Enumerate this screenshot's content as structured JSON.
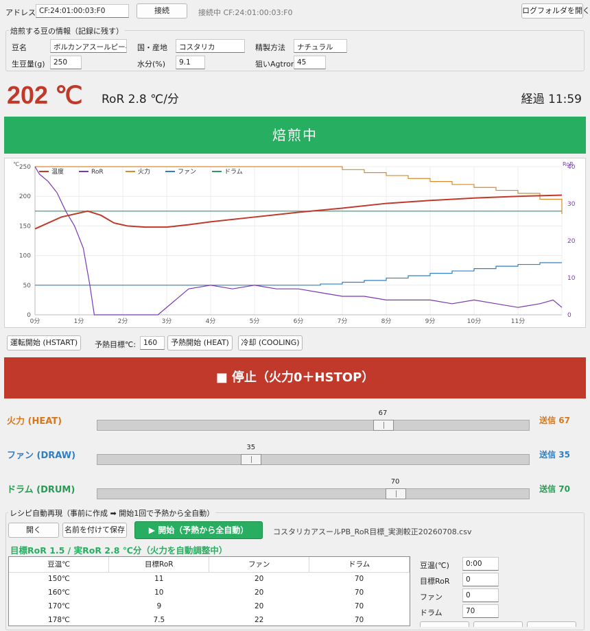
{
  "connection": {
    "address_label": "アドレス:",
    "address_value": "CF:24:01:00:03:F0",
    "connect_button": "接続",
    "status": "接続中 CF:24:01:00:03:F0",
    "log_folder_button": "ログフォルダを開く"
  },
  "bean_info": {
    "title": "焙煎する豆の情報（記録に残す）",
    "name_label": "豆名",
    "name_value": "ボルカンアスールピーベリ",
    "origin_label": "国・産地",
    "origin_value": "コスタリカ",
    "process_label": "精製方法",
    "process_value": "ナチュラル",
    "weight_label": "生豆量(g)",
    "weight_value": "250",
    "moisture_label": "水分(%)",
    "moisture_value": "9.1",
    "agtron_label": "狙いAgtron",
    "agtron_value": "45"
  },
  "readout": {
    "temperature": "202 ℃",
    "ror": "RoR 2.8 ℃/分",
    "elapsed": "経過 11:59"
  },
  "status_banner": "焙煎中",
  "colors": {
    "banner": "#27ae60",
    "stop": "#c0392b",
    "temp_line": "#c0392b",
    "ror_line": "#7a36b8",
    "heat_line": "#d88a2a",
    "fan_line": "#2e7fc4",
    "drum_line": "#2a9a60"
  },
  "chart_data": {
    "type": "line",
    "title": "",
    "ylabel_left": "℃",
    "ylabel_right": "RoR",
    "xlim": [
      0,
      12
    ],
    "ylim_left": [
      0,
      250
    ],
    "ylim_right": [
      0,
      40
    ],
    "x_ticks": [
      "0分",
      "1分",
      "2分",
      "3分",
      "4分",
      "5分",
      "6分",
      "7分",
      "8分",
      "9分",
      "10分",
      "11分"
    ],
    "y_ticks_left": [
      "0",
      "50",
      "100",
      "150",
      "200",
      "250"
    ],
    "y_ticks_right": [
      "0",
      "10",
      "20",
      "30",
      "40"
    ],
    "legend": [
      "温度",
      "RoR",
      "火力",
      "ファン",
      "ドラム"
    ],
    "legend_position": "top-left",
    "grid": true,
    "series": [
      {
        "name": "温度",
        "axis": "left",
        "x": [
          0,
          0.3,
          0.6,
          0.9,
          1.2,
          1.5,
          1.8,
          2.1,
          2.5,
          3,
          3.5,
          4,
          5,
          6,
          7,
          8,
          9,
          10,
          11,
          12
        ],
        "y": [
          145,
          155,
          165,
          170,
          175,
          168,
          155,
          150,
          148,
          148,
          152,
          157,
          165,
          173,
          180,
          188,
          193,
          197,
          200,
          202
        ]
      },
      {
        "name": "RoR",
        "axis": "right",
        "x": [
          0,
          0.1,
          0.3,
          0.5,
          0.7,
          0.9,
          1.1,
          1.25,
          1.35,
          2,
          2.8,
          3.2,
          3.5,
          4,
          4.5,
          5,
          5.5,
          6,
          6.5,
          7,
          7.5,
          8,
          8.5,
          9,
          9.5,
          10,
          10.5,
          11,
          11.5,
          11.8,
          12
        ],
        "y": [
          40,
          38,
          36,
          33,
          28,
          24,
          18,
          8,
          0,
          0,
          0,
          4,
          7,
          8,
          7,
          8,
          7,
          7,
          6,
          5,
          5,
          4,
          4,
          4,
          3,
          4,
          3,
          2,
          3,
          4,
          2
        ]
      },
      {
        "name": "火力",
        "axis": "left",
        "x": [
          0,
          1,
          2,
          3,
          4,
          5,
          6,
          7,
          7.5,
          8,
          8.5,
          9,
          9.5,
          10,
          10.5,
          11,
          11.5,
          12
        ],
        "y": [
          250,
          250,
          250,
          250,
          250,
          250,
          250,
          245,
          240,
          235,
          230,
          225,
          220,
          215,
          210,
          205,
          195,
          170
        ]
      },
      {
        "name": "ファン",
        "axis": "left",
        "x": [
          0,
          1,
          2,
          3,
          4,
          5,
          6,
          6.5,
          7,
          7.5,
          8,
          8.5,
          9,
          9.5,
          10,
          10.5,
          11,
          11.5,
          12
        ],
        "y": [
          50,
          50,
          50,
          50,
          50,
          50,
          50,
          52,
          55,
          58,
          62,
          66,
          70,
          74,
          78,
          82,
          85,
          88,
          88
        ]
      },
      {
        "name": "ドラム",
        "axis": "left",
        "x": [
          0,
          12
        ],
        "y": [
          175,
          175
        ]
      }
    ]
  },
  "controls": {
    "hstart_button": "運転開始 (HSTART)",
    "preheat_target_label": "予熱目標℃:",
    "preheat_target_value": "160",
    "preheat_button": "予熱開始 (HEAT)",
    "cooling_button": "冷却 (COOLING)",
    "stop_button": "■ 停止（火力0＋HSTOP）"
  },
  "sliders": {
    "heat": {
      "label": "火力 (HEAT)",
      "value": 67,
      "value_text": "67",
      "sent": "送信 67"
    },
    "fan": {
      "label": "ファン (DRAW)",
      "value": 35,
      "value_text": "35",
      "sent": "送信 35"
    },
    "drum": {
      "label": "ドラム (DRUM)",
      "value": 70,
      "value_text": "70",
      "sent": "送信 70"
    }
  },
  "recipe": {
    "title": "レシピ自動再現（事前に作成 ➡ 開始1回で予熱から全自動）",
    "open_button": "開く",
    "save_button": "名前を付けて保存",
    "start_button": "▶ 開始（予熱から全自動）",
    "file_name": "コスタリカアスールPB_RoR目標_実測較正20260708.csv",
    "status": "目標RoR 1.5 / 実RoR 2.8 ℃分（火力を自動調整中）",
    "columns": [
      "豆温℃",
      "目標RoR",
      "ファン",
      "ドラム"
    ],
    "rows": [
      [
        "150℃",
        "11",
        "20",
        "70"
      ],
      [
        "160℃",
        "10",
        "20",
        "70"
      ],
      [
        "170℃",
        "9",
        "20",
        "70"
      ],
      [
        "178℃",
        "7.5",
        "22",
        "70"
      ]
    ],
    "edit_temp_label": "豆温(℃)",
    "edit_temp_value": "0:00",
    "edit_ror_label": "目標RoR",
    "edit_ror_value": "0",
    "edit_fan_label": "ファン",
    "edit_fan_value": "0",
    "edit_drum_label": "ドラム",
    "edit_drum_value": "70"
  }
}
